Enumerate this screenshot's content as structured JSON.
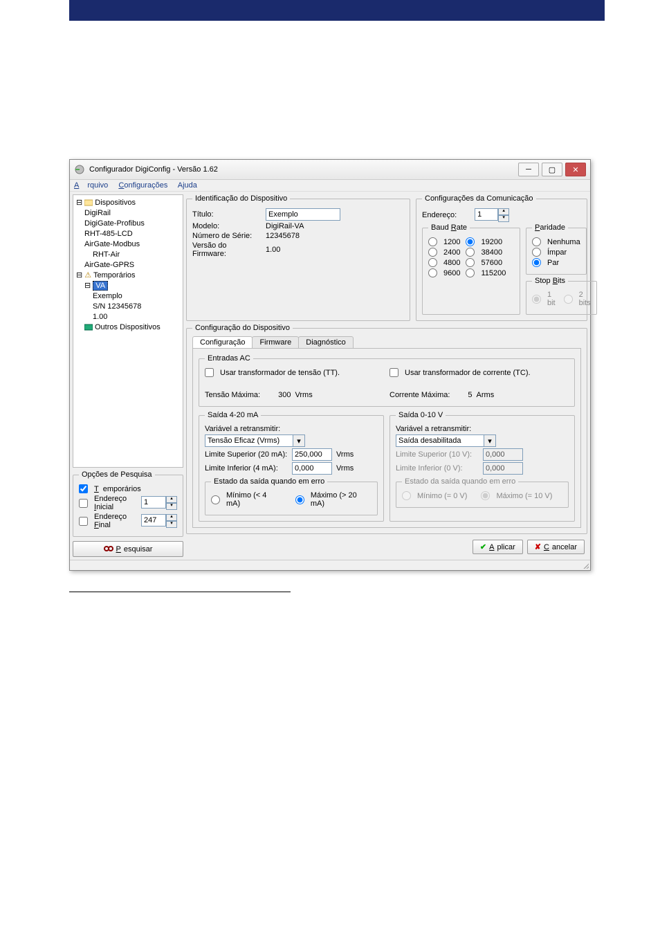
{
  "window": {
    "title": "Configurador DigiConfig - Versão 1.62"
  },
  "menu": {
    "file": "Arquivo",
    "config": "Configurações",
    "help": "Ajuda"
  },
  "tree": {
    "root": "Dispositivos",
    "items": [
      "DigiRail",
      "DigiGate-Profibus",
      "RHT-485-LCD",
      "AirGate-Modbus",
      "RHT-Air",
      "AirGate-GPRS"
    ],
    "temp": "Temporários",
    "selected": "VA",
    "example": "Exemplo",
    "sn": "S/N 12345678",
    "ver": "1.00",
    "other": "Outros Dispositivos"
  },
  "search": {
    "legend": "Opções de Pesquisa",
    "temp": "Temporários",
    "ini_lbl": "Endereço Inicial",
    "ini_val": "1",
    "fin_lbl": "Endereço Final",
    "fin_val": "247",
    "btn": "Pesquisar"
  },
  "ident": {
    "legend": "Identificação do Dispositivo",
    "title_lbl": "Título:",
    "title_val": "Exemplo",
    "model_lbl": "Modelo:",
    "model_val": "DigiRail-VA",
    "sn_lbl": "Número de Série:",
    "sn_val": "12345678",
    "fw_lbl": "Versão do Firmware:",
    "fw_val": "1.00"
  },
  "comm": {
    "legend": "Configurações da Comunicação",
    "addr_lbl": "Endereço:",
    "addr_val": "1",
    "baud_legend": "Baud Rate",
    "b1200": "1200",
    "b2400": "2400",
    "b4800": "4800",
    "b9600": "9600",
    "b19200": "19200",
    "b38400": "38400",
    "b57600": "57600",
    "b115200": "115200",
    "parity_legend": "Paridade",
    "p_none": "Nenhuma",
    "p_odd": "Ímpar",
    "p_even": "Par",
    "stop_legend": "Stop Bits",
    "s1": "1 bit",
    "s2": "2 bits"
  },
  "cfg": {
    "legend": "Configuração do Dispositivo",
    "tab_cfg": "Configuração",
    "tab_fw": "Firmware",
    "tab_diag": "Diagnóstico",
    "ac_legend": "Entradas AC",
    "tt": "Usar transformador de tensão (TT).",
    "tc": "Usar transformador de corrente (TC).",
    "vmax_lbl": "Tensão Máxima:",
    "vmax_val": "300",
    "vmax_unit": "Vrms",
    "cmax_lbl": "Corrente Máxima:",
    "cmax_val": "5",
    "cmax_unit": "Arms",
    "o420_legend": "Saída 4-20 mA",
    "o010_legend": "Saída 0-10 V",
    "retr_lbl": "Variável a retransmitir:",
    "o420_sel": "Tensão Eficaz (Vrms)",
    "o010_sel": "Saída desabilitada",
    "lim_sup_420": "Limite Superior (20 mA):",
    "lim_inf_420": "Limite Inferior (4 mA):",
    "lim_sup_010": "Limite Superior (10 V):",
    "lim_inf_010": "Limite Inferior (0 V):",
    "v250": "250,000",
    "v0": "0,000",
    "unit_v": "Vrms",
    "err_legend": "Estado da saída quando em erro",
    "min420": "Mínimo (< 4 mA)",
    "max420": "Máximo (> 20 mA)",
    "min010": "Mínimo (= 0 V)",
    "max010": "Máximo (= 10 V)"
  },
  "buttons": {
    "apply": "Aplicar",
    "cancel": "Cancelar"
  }
}
